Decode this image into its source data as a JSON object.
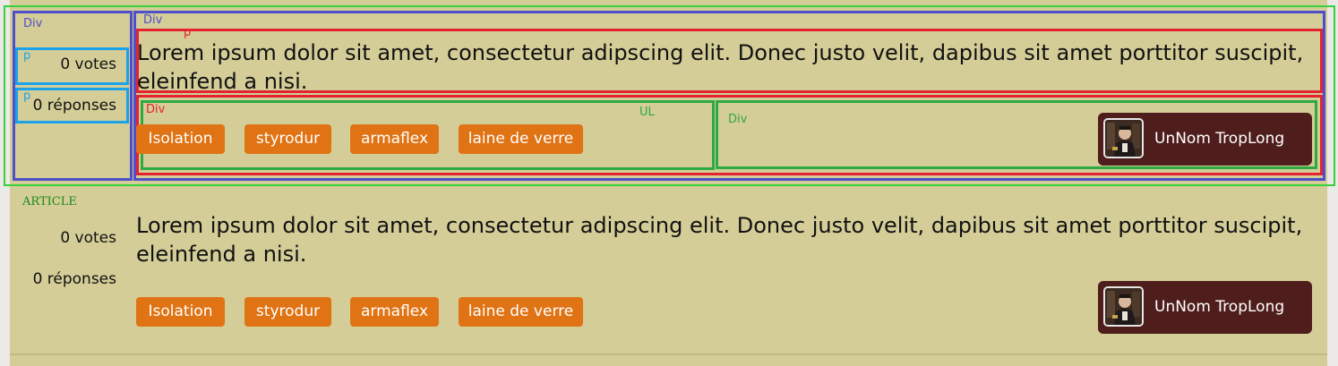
{
  "debug_labels": {
    "div": "Div",
    "p": "p",
    "ul": "UL",
    "article": "ARTICLE"
  },
  "questions": [
    {
      "votes": "0 votes",
      "answers": "0 réponses",
      "title": "Lorem ipsum dolor sit amet, consectetur adipscing elit. Donec justo velit, dapibus sit amet porttitor suscipit, eleinfend a nisi.",
      "tags": [
        "Isolation",
        "styrodur",
        "armaflex",
        "laine de verre"
      ],
      "user": {
        "name": "UnNom TropLong",
        "avatar_icon": "user-avatar-photo"
      }
    },
    {
      "votes": "0 votes",
      "answers": "0 réponses",
      "title": "Lorem ipsum dolor sit amet, consectetur adipscing elit. Donec justo velit, dapibus sit amet porttitor suscipit, eleinfend a nisi.",
      "tags": [
        "Isolation",
        "styrodur",
        "armaflex",
        "laine de verre"
      ],
      "user": {
        "name": "UnNom TropLong",
        "avatar_icon": "user-avatar-photo"
      }
    }
  ],
  "colors": {
    "background": "#d4cd97",
    "tag": "#e07314",
    "user_card": "#4f1e1c"
  }
}
